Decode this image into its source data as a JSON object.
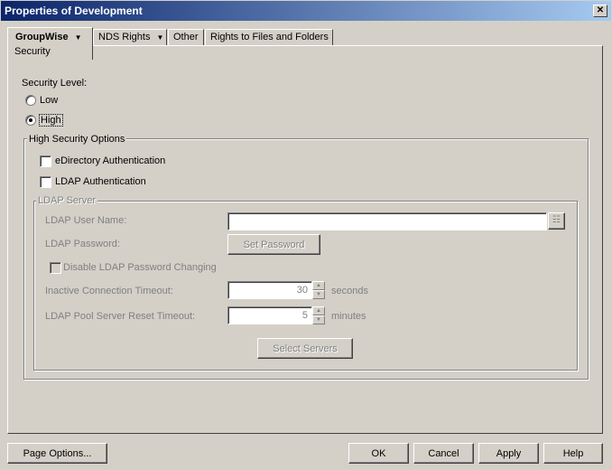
{
  "window": {
    "title": "Properties of Development",
    "close_glyph": "✕"
  },
  "tabs": [
    {
      "label": "GroupWise",
      "sub_label": "Security",
      "has_dropdown": true,
      "active": true
    },
    {
      "label": "NDS Rights",
      "has_dropdown": true
    },
    {
      "label": "Other"
    },
    {
      "label": "Rights to Files and Folders"
    }
  ],
  "security": {
    "level_label": "Security Level:",
    "low_label": "Low",
    "high_label": "High",
    "selected": "High"
  },
  "high_options": {
    "group_label": "High Security Options",
    "edirectory_label": "eDirectory Authentication",
    "ldap_auth_label": "LDAP Authentication",
    "edirectory_checked": false,
    "ldap_auth_checked": false
  },
  "ldap_server": {
    "group_label": "LDAP Server",
    "user_name_label": "LDAP User Name:",
    "user_name_value": "",
    "password_label": "LDAP Password:",
    "set_password_label": "Set Password",
    "disable_pw_change_label": "Disable LDAP Password Changing",
    "inactive_timeout_label": "Inactive Connection Timeout:",
    "inactive_timeout_value": "30",
    "inactive_timeout_unit": "seconds",
    "pool_reset_label": "LDAP Pool Server Reset Timeout:",
    "pool_reset_value": "5",
    "pool_reset_unit": "minutes",
    "select_servers_label": "Select Servers"
  },
  "footer": {
    "page_options_label": "Page Options...",
    "ok_label": "OK",
    "cancel_label": "Cancel",
    "apply_label": "Apply",
    "help_label": "Help"
  },
  "icons": {
    "dropdown_arrow": "chevron-down-icon",
    "browse": "browse-list-icon",
    "spin_up": "spin-up-icon",
    "spin_down": "spin-down-icon"
  }
}
